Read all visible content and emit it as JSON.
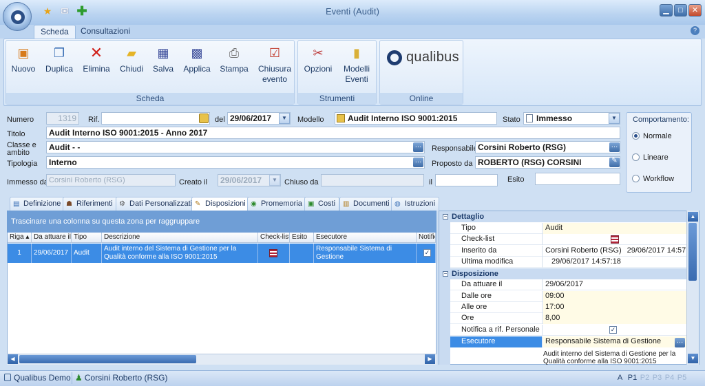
{
  "window": {
    "title": "Eventi (Audit)"
  },
  "ribbon_tabs": [
    "Scheda",
    "Consultazioni"
  ],
  "ribbon": {
    "buttons": [
      {
        "label": "Nuovo",
        "icon": "new-doc-icon"
      },
      {
        "label": "Duplica",
        "icon": "duplicate-icon"
      },
      {
        "label": "Elimina",
        "icon": "delete-x-icon"
      },
      {
        "label": "Chiudi",
        "icon": "close-folder-icon"
      },
      {
        "label": "Salva",
        "icon": "save-disk-icon"
      },
      {
        "label": "Applica",
        "icon": "apply-icon"
      },
      {
        "label": "Stampa",
        "icon": "printer-icon"
      },
      {
        "label": "Chiusura\nevento",
        "icon": "close-event-icon"
      },
      {
        "label": "Opzioni",
        "icon": "tools-icon"
      },
      {
        "label": "Modelli\nEventi",
        "icon": "templates-icon"
      }
    ],
    "groups": [
      "Scheda",
      "Strumenti",
      "Online"
    ],
    "logo": "qualibus"
  },
  "form": {
    "numero_label": "Numero",
    "numero": "1319",
    "rif_label": "Rif.",
    "rif": "",
    "del_label": "del",
    "del": "29/06/2017",
    "modello_label": "Modello",
    "modello": "Audit Interno ISO 9001:2015",
    "stato_label": "Stato",
    "stato": "Immesso",
    "titolo_label": "Titolo",
    "titolo": "Audit Interno ISO 9001:2015 - Anno 2017",
    "classe_label": "Classe e\nambito",
    "classe": "Audit - -",
    "responsabile_label": "Responsabile",
    "responsabile": "Corsini Roberto (RSG)",
    "tipologia_label": "Tipologia",
    "tipologia": "Interno",
    "proposto_label": "Proposto da",
    "proposto": "ROBERTO (RSG) CORSINI",
    "immesso_label": "Immesso da",
    "immesso": "Corsini Roberto (RSG)",
    "creato_label": "Creato il",
    "creato": "29/06/2017",
    "chiuso_label": "Chiuso da",
    "chiuso": "",
    "il_label": "il",
    "il": "",
    "esito_label": "Esito",
    "esito": ""
  },
  "comportamento": {
    "title": "Comportamento:",
    "options": [
      "Normale",
      "Lineare",
      "Workflow"
    ],
    "selected": "Normale"
  },
  "detail_tabs": [
    "Definizione",
    "Riferimenti",
    "Dati Personalizzati",
    "Disposizioni",
    "Promemoria",
    "Costi",
    "Documenti",
    "Istruzioni"
  ],
  "active_detail_tab": "Disposizioni",
  "grid": {
    "group_hint": "Trascinare una colonna su questa zona per raggruppare",
    "columns": [
      "Riga",
      "Da attuare il",
      "Tipo",
      "Descrizione",
      "Check-list",
      "Esito",
      "Esecutore",
      "Notific"
    ],
    "rows": [
      {
        "riga": "1",
        "data": "29/06/2017",
        "tipo": "Audit",
        "descrizione": "Audit interno del Sistema di Gestione per la Qualità conforme alla ISO 9001:2015",
        "esito": "",
        "esecutore": "Responsabile Sistema di Gestione"
      }
    ]
  },
  "details": {
    "dettaglio": {
      "title": "Dettaglio",
      "rows": [
        {
          "k": "Tipo",
          "v": "Audit"
        },
        {
          "k": "Check-list",
          "v": ""
        },
        {
          "k": "Inserito da",
          "v": "Corsini Roberto (RSG)",
          "v2": "29/06/2017 14:57:18"
        },
        {
          "k": "Ultima modifica",
          "v": "",
          "v2": "29/06/2017 14:57:18"
        }
      ]
    },
    "disposizione": {
      "title": "Disposizione",
      "rows": [
        {
          "k": "Da attuare il",
          "v": "29/06/2017"
        },
        {
          "k": "Dalle ore",
          "v": "09:00"
        },
        {
          "k": "Alle ore",
          "v": "17:00"
        },
        {
          "k": "Ore",
          "v": "8,00"
        },
        {
          "k": "Notifica a rif. Personale",
          "v": ""
        },
        {
          "k": "Esecutore",
          "v": "Responsabile Sistema di Gestione"
        }
      ]
    },
    "description": "Audit interno del Sistema di Gestione per la Qualità conforme alla ISO 9001:2015"
  },
  "status": {
    "app": "Qualibus Demo",
    "user": "Corsini Roberto (RSG)",
    "pages": [
      "A",
      "P1",
      "P2",
      "P3",
      "P4",
      "P5"
    ]
  }
}
